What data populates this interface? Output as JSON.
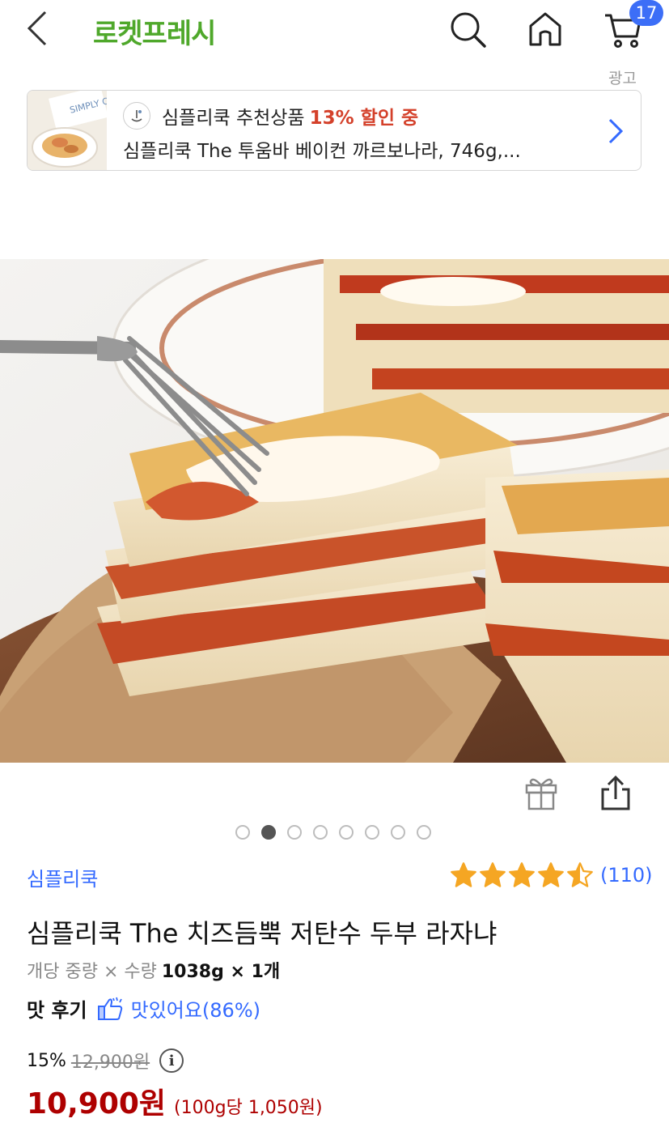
{
  "header": {
    "brand": "로켓프레시",
    "cart_count": "17",
    "back_icon": "chevron-left-icon",
    "search_icon": "search-icon",
    "home_icon": "home-icon",
    "cart_icon": "cart-icon"
  },
  "ad": {
    "label": "광고",
    "thumb_text": "SIMPLY COOK",
    "title": "심플리쿡 추천상품",
    "discount": "13% 할인 중",
    "description": "심플리쿡 The 투움바 베이컨 까르보나라, 746g,..."
  },
  "gallery": {
    "dot_count": 8,
    "active_index": 1
  },
  "product": {
    "seller": "심플리쿡",
    "rating": 4.5,
    "review_count": "(110)",
    "title": "심플리쿡 The 치즈듬뿍 저탄수 두부 라자냐",
    "weight_label": "개당 중량 × 수량",
    "weight_value": "1038g × 1개",
    "taste_label": "맛 후기",
    "taste_value": "맛있어요(86%)",
    "discount_rate": "15%",
    "original_price": "12,900원",
    "sale_price": "10,900원",
    "unit_price": "(100g당 1,050원)"
  },
  "colors": {
    "brand_green": "#4fa82b",
    "link_blue": "#346aff",
    "price_red": "#ae0000",
    "star_yellow": "#f5a623",
    "badge_blue": "#3c6ef7"
  }
}
